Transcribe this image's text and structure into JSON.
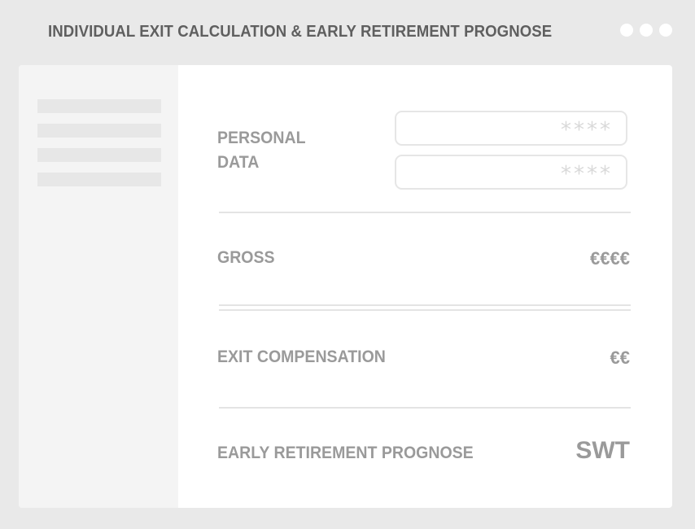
{
  "window": {
    "title": "INDIVIDUAL EXIT CALCULATION & EARLY RETIREMENT PROGNOSE"
  },
  "personal": {
    "label_line1": "PERSONAL",
    "label_line2": "DATA",
    "field1_value": "****",
    "field2_value": "****"
  },
  "gross": {
    "label": "GROSS",
    "value": "€€€€"
  },
  "exit": {
    "label": "EXIT COMPENSATION",
    "value": "€€"
  },
  "early": {
    "label": "EARLY RETIREMENT PROGNOSE",
    "value": "SWT"
  },
  "colors": {
    "background": "#e9e9e9",
    "panel": "#ffffff",
    "sidebar": "#f4f4f4",
    "title_text": "#5f5f5f",
    "label_text": "#9a9a9a"
  }
}
